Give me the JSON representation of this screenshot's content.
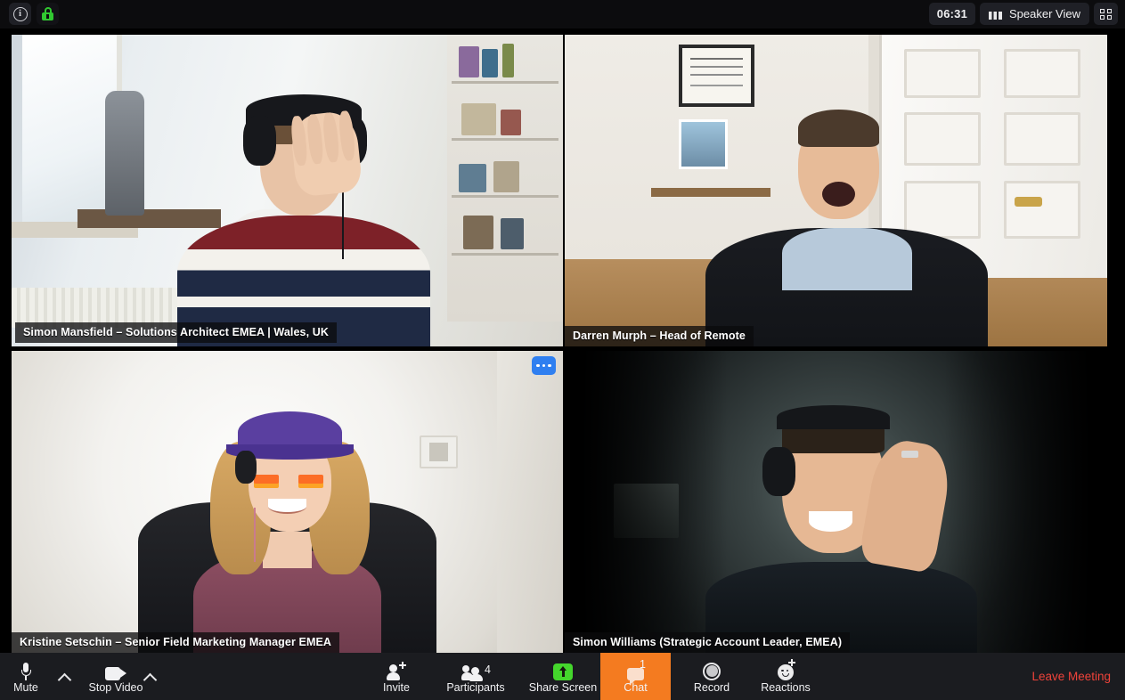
{
  "topbar": {
    "info_icon": "info-circle-icon",
    "lock_icon": "green-padlock-icon",
    "clock": "06:31",
    "view_mode_label": "Speaker View",
    "view_mode_icon": "grid-view-icon",
    "fullscreen_icon": "enter-fullscreen-icon"
  },
  "participants": [
    {
      "name": "Simon Mansfield – Solutions Architect EMEA | Wales, UK",
      "active_speaker": true,
      "active_border_color": "#cbe05a",
      "has_more_menu": false
    },
    {
      "name": "Darren Murph – Head of Remote",
      "active_speaker": false,
      "has_more_menu": false
    },
    {
      "name": "Kristine Setschin – Senior Field Marketing Manager EMEA",
      "active_speaker": false,
      "has_more_menu": true,
      "more_menu_icon": "more-options-dots-icon"
    },
    {
      "name": "Simon Williams (Strategic Account Leader, EMEA)",
      "active_speaker": false,
      "has_more_menu": false
    }
  ],
  "toolbar": {
    "mute_label": "Mute",
    "mute_icon": "microphone-icon",
    "audio_menu_icon": "chevron-up-icon",
    "video_label": "Stop Video",
    "video_icon": "camera-icon",
    "video_menu_icon": "chevron-up-icon",
    "invite_label": "Invite",
    "invite_icon": "person-add-icon",
    "participants_label": "Participants",
    "participants_icon": "people-icon",
    "participants_count": "4",
    "share_label": "Share Screen",
    "share_icon": "share-screen-arrow-icon",
    "share_accent_color": "#44d62c",
    "chat_label": "Chat",
    "chat_icon": "chat-bubble-icon",
    "chat_count": "1",
    "chat_active_color": "#f47b20",
    "record_label": "Record",
    "record_icon": "record-circle-icon",
    "reactions_label": "Reactions",
    "reactions_icon": "smiley-add-icon",
    "leave_label": "Leave Meeting",
    "leave_color": "#f0433a"
  }
}
